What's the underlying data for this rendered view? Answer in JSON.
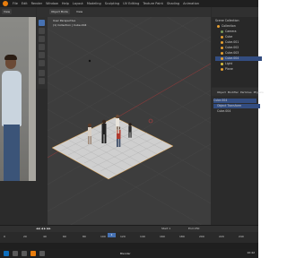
{
  "app": {
    "menu": [
      "File",
      "Edit",
      "Render",
      "Window",
      "Help",
      "Layout",
      "Modeling",
      "Sculpting",
      "UV Editing",
      "Texture Paint",
      "Shading",
      "Animation"
    ]
  },
  "viewport": {
    "mode_label": "Object Mode",
    "view_label": "View",
    "info_line1": "User Perspective",
    "info_line2": "(1) Collection | Cube.004",
    "figures": [
      "woman-figure-1",
      "man-figure",
      "woman-figure-2",
      "woman-figure-3",
      "child-figure"
    ]
  },
  "image_panel": {
    "mode_label": "View"
  },
  "outliner": {
    "title": "Scene Collection",
    "items": [
      {
        "label": "Scene Collection",
        "selected": false
      },
      {
        "label": "Collection",
        "selected": false
      },
      {
        "label": "Camera",
        "selected": false
      },
      {
        "label": "Cube",
        "selected": false
      },
      {
        "label": "Cube.001",
        "selected": false
      },
      {
        "label": "Cube.002",
        "selected": false
      },
      {
        "label": "Cube.003",
        "selected": false
      },
      {
        "label": "Cube.004",
        "selected": true
      },
      {
        "label": "Light",
        "selected": false
      },
      {
        "label": "Plane",
        "selected": false
      }
    ]
  },
  "properties": {
    "tabs": [
      "Object",
      "Modifier",
      "Particles",
      "Physics"
    ],
    "rows": [
      {
        "label": "Cube.004",
        "selected": true
      },
      {
        "label": "Object Transform",
        "selected": true
      },
      {
        "label": "Cube.004",
        "selected": false
      }
    ]
  },
  "timeline": {
    "current_frame": "1",
    "start": "Start 1",
    "end": "End 250",
    "ruler": [
      "0",
      "20",
      "40",
      "60",
      "80",
      "100",
      "120",
      "140",
      "160",
      "180",
      "200",
      "220",
      "240"
    ]
  },
  "taskbar": {
    "time": "10:42",
    "app_label": "Blender"
  }
}
